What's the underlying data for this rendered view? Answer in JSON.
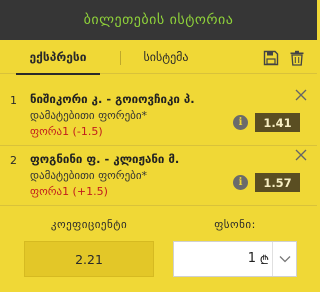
{
  "header": {
    "title": "ბილეთების ისტორია"
  },
  "tabs": {
    "express_label": "ექსპრესი",
    "system_label": "სისტემა"
  },
  "bets": [
    {
      "index": "1",
      "teams": "ნიშიკორი კ. - გოიოვჩიკი პ.",
      "market": "დამატებითი ფორები*",
      "pick": "ფორა1 (-1.5)",
      "odds": "1.41"
    },
    {
      "index": "2",
      "teams": "ფოგნინი ფ. - კლიჟანი მ.",
      "market": "დამატებითი ფორები*",
      "pick": "ფორა1 (+1.5)",
      "odds": "1.57"
    }
  ],
  "info_glyph": "i",
  "footer": {
    "coefficient_label": "კოეფიციენტი",
    "coefficient_value": "2.21",
    "stake_label": "ფსონი:",
    "stake_value": "1",
    "currency": "₾"
  },
  "colors": {
    "header_bg": "#363636",
    "header_text": "#8fd23a",
    "panel_bg": "#f0d836",
    "odds_bg": "#5a4e22",
    "pick_text": "#c21d1d"
  },
  "icons": [
    "save-icon",
    "trash-icon",
    "close-icon",
    "info-icon",
    "chevron-down-icon"
  ]
}
